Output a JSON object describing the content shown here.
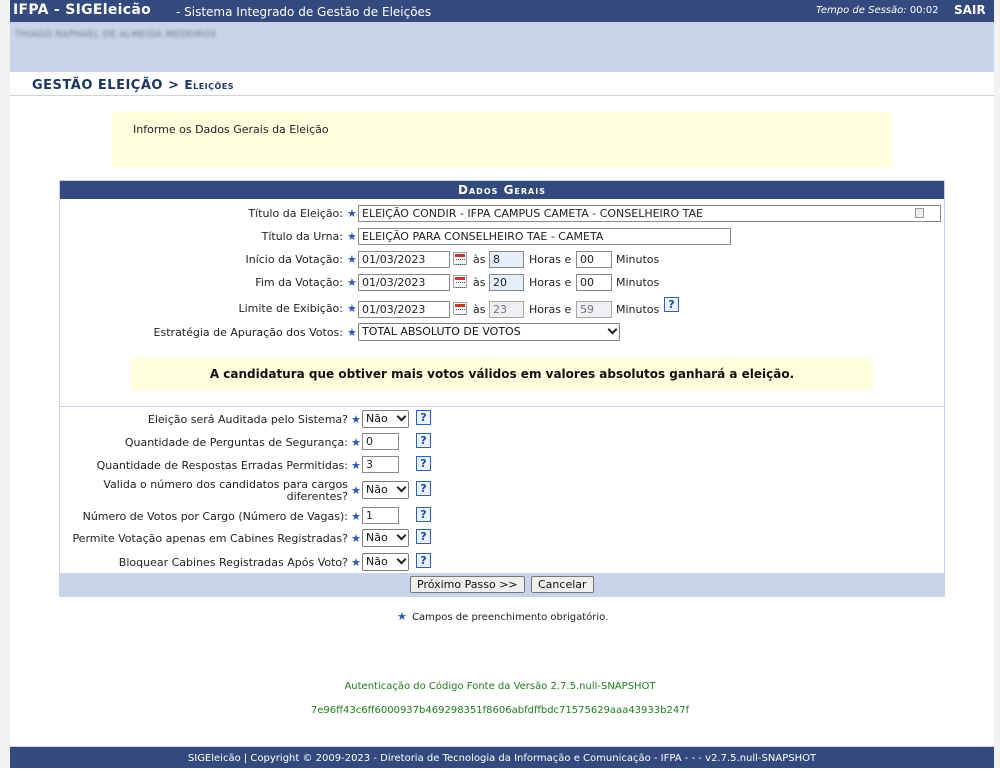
{
  "header": {
    "brand": "IFPA - SIGEleicão",
    "subtitle": "- Sistema Integrado de Gestão de Eleições",
    "session_label": "Tempo de Sessão:",
    "session_time": "00:02",
    "exit": "SAIR"
  },
  "user": {
    "name": "THIAGO RAPHAEL DE ALMEIDA MEDEIROS"
  },
  "breadcrumb": {
    "main": "GESTÃO ELEIÇÃO >",
    "sub": "Eleições"
  },
  "info": "Informe os Dados Gerais da Eleição",
  "form": {
    "caption": "Dados Gerais",
    "title_label": "Título da Eleição:",
    "title_value": "ELEIÇÃO CONDIR - IFPA CAMPUS CAMETA - CONSELHEIRO TAE",
    "urn_label": "Título da Urna:",
    "urn_value": "ELEIÇÃO PARA CONSELHEIRO TAE - CAMETA",
    "start_label": "Início da Votação:",
    "start_date": "01/03/2023",
    "start_hour": "8",
    "start_min": "00",
    "end_label": "Fim da Votação:",
    "end_date": "01/03/2023",
    "end_hour": "20",
    "end_min": "00",
    "limit_label": "Limite de Exibição:",
    "limit_date": "01/03/2023",
    "limit_hour": "23",
    "limit_min": "59",
    "at": "às",
    "hours_and": "Horas e",
    "minutes": "Minutos",
    "strategy_label": "Estratégia de Apuração dos Votos:",
    "strategy_value": "TOTAL ABSOLUTO DE VOTOS",
    "notice": "A candidatura que obtiver mais votos válidos em valores absolutos ganhará a eleição.",
    "audit_label": "Eleição será Auditada pelo Sistema?",
    "audit_value": "Não",
    "questions_label": "Quantidade de Perguntas de Segurança:",
    "questions_value": "0",
    "wrong_label": "Quantidade de Respostas Erradas Permitidas:",
    "wrong_value": "3",
    "validate_label_1": "Valida o número dos candidatos para cargos",
    "validate_label_2": "diferentes?",
    "validate_value": "Não",
    "votes_label": "Número de Votos por Cargo (Número de Vagas):",
    "votes_value": "1",
    "cabins_label": "Permite Votação apenas em Cabines Registradas?",
    "cabins_value": "Não",
    "block_label": "Bloquear Cabines Registradas Após Voto?",
    "block_value": "Não",
    "next_button": "Próximo Passo >>",
    "cancel_button": "Cancelar"
  },
  "required_note": "Campos de preenchimento obrigatório.",
  "auth": {
    "line1": "Autenticação do Código Fonte da Versão 2.7.5.null-SNAPSHOT",
    "line2": "7e96ff43c6ff6000937b469298351f8606abfdffbdc71575629aaa43933b247f"
  },
  "footer": "SIGEleicão | Copyright © 2009-2023 - Diretoria de Tecnologia da Informação e Comunicação - IFPA - - - v2.7.5.null-SNAPSHOT",
  "colors": {
    "header": "#344a7f",
    "light": "#c8d4ea",
    "notice": "#ffffdd",
    "auth": "#1f7a1f"
  },
  "icons": [
    "calendar-icon",
    "help-icon",
    "required-star-icon",
    "dropdown-chevron-icon",
    "text-field-icon"
  ]
}
